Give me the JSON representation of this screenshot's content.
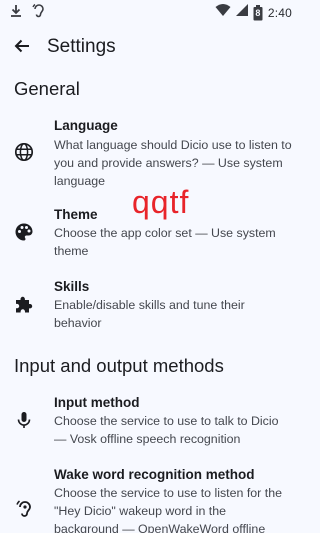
{
  "status_bar": {
    "time": "2:40",
    "battery_level": "8",
    "icons": [
      "download-icon",
      "hearing-icon",
      "wifi-icon",
      "signal-icon",
      "battery-icon"
    ]
  },
  "app_bar": {
    "back_icon": "arrow-back-icon",
    "title": "Settings"
  },
  "sections": {
    "general": {
      "header": "General",
      "language": {
        "icon": "globe-icon",
        "title": "Language",
        "summary": "What language should Dicio use to listen to you and provide answers? — Use system language"
      },
      "theme": {
        "icon": "palette-icon",
        "title": "Theme",
        "summary": "Choose the app color set — Use system theme"
      },
      "skills": {
        "icon": "puzzle-icon",
        "title": "Skills",
        "summary": "Enable/disable skills and tune their behavior"
      }
    },
    "io": {
      "header": "Input and output methods",
      "input_method": {
        "icon": "mic-icon",
        "title": "Input method",
        "summary": "Choose the service to use to talk to Dicio — Vosk offline speech recognition"
      },
      "wake_word": {
        "icon": "hearing-icon",
        "title": "Wake word recognition method",
        "summary": "Choose the service to use to listen for the \"Hey Dicio\" wakeup word in the background — OpenWakeWord offline"
      }
    }
  },
  "overlay_text": "qqtf",
  "colors": {
    "background": "#f7f9ff",
    "text_primary": "#1b1c20",
    "text_secondary": "#44474e",
    "overlay_red": "#e8242a"
  }
}
